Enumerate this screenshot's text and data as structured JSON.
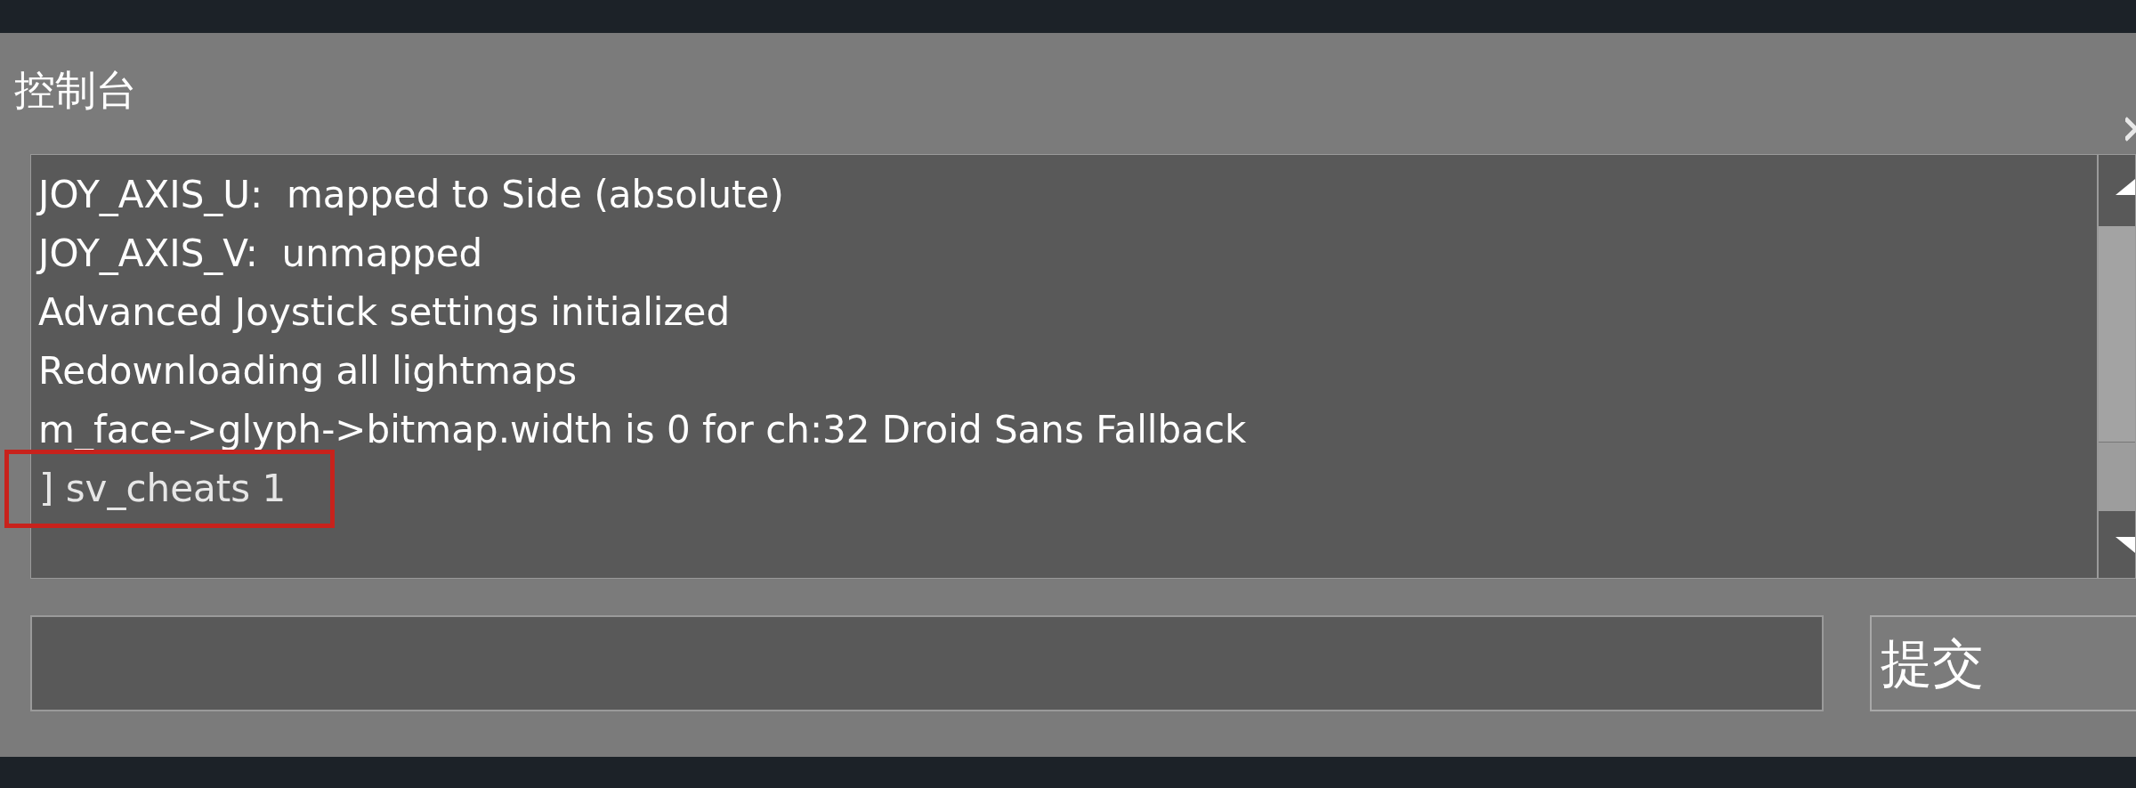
{
  "window": {
    "title": "控制台"
  },
  "log_lines": [
    {
      "text": "JOY_AXIS_U:  mapped to Side (absolute)",
      "highlighted": false
    },
    {
      "text": "JOY_AXIS_V:  unmapped",
      "highlighted": false
    },
    {
      "text": "Advanced Joystick settings initialized",
      "highlighted": false
    },
    {
      "text": "Redownloading all lightmaps",
      "highlighted": false
    },
    {
      "text": "m_face->glyph->bitmap.width is 0 for ch:32 Droid Sans Fallback",
      "highlighted": false
    },
    {
      "text": "] sv_cheats 1",
      "highlighted": true
    }
  ],
  "submit_button": {
    "label": "提交"
  }
}
